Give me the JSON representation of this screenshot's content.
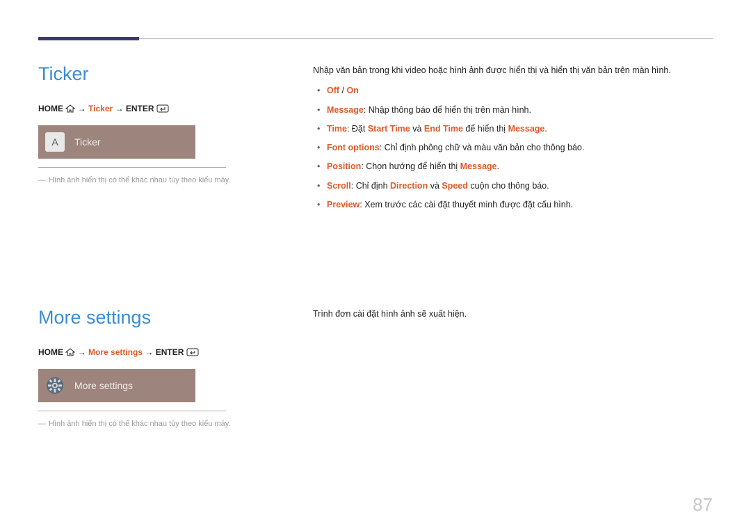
{
  "pageNumber": "87",
  "section1": {
    "heading": "Ticker",
    "breadcrumb": {
      "home": "HOME",
      "arrow": " → ",
      "page": "Ticker",
      "enter": "ENTER"
    },
    "chipIcon": "A",
    "chipLabel": "Ticker",
    "note": "Hình ảnh hiển thị có thể khác nhau tùy theo kiểu máy.",
    "intro": "Nhập văn bản trong khi video hoặc hình ảnh được hiển thị và hiển thị văn bản trên màn hình.",
    "bullets": {
      "b1": {
        "off": "Off",
        "sep": " / ",
        "on": "On"
      },
      "b2": {
        "label": "Message",
        "text": ": Nhập thông báo để hiển thị trên màn hình."
      },
      "b3": {
        "label": "Time",
        "p1": ": Đặt ",
        "st": "Start Time",
        "p2": " và ",
        "et": "End Time",
        "p3": " để hiển thị ",
        "msg": "Message",
        "p4": "."
      },
      "b4": {
        "label": "Font options",
        "text": ": Chỉ định phông chữ và màu văn bản cho thông báo."
      },
      "b5": {
        "label": "Position",
        "p1": ": Chọn hướng để hiển thị ",
        "msg": "Message",
        "p2": "."
      },
      "b6": {
        "label": "Scroll",
        "p1": ": Chỉ định ",
        "dir": "Direction",
        "p2": " và ",
        "spd": "Speed",
        "p3": " cuộn cho thông báo."
      },
      "b7": {
        "label": "Preview",
        "text": ": Xem trước các cài đặt thuyết minh được đặt cấu hình."
      }
    }
  },
  "section2": {
    "heading": "More settings",
    "breadcrumb": {
      "home": "HOME",
      "arrow": " → ",
      "page": "More settings",
      "enter": "ENTER"
    },
    "chipLabel": "More settings",
    "note": "Hình ảnh hiển thị có thể khác nhau tùy theo kiểu máy.",
    "intro": "Trình đơn cài đặt hình ảnh sẽ xuất hiện."
  }
}
